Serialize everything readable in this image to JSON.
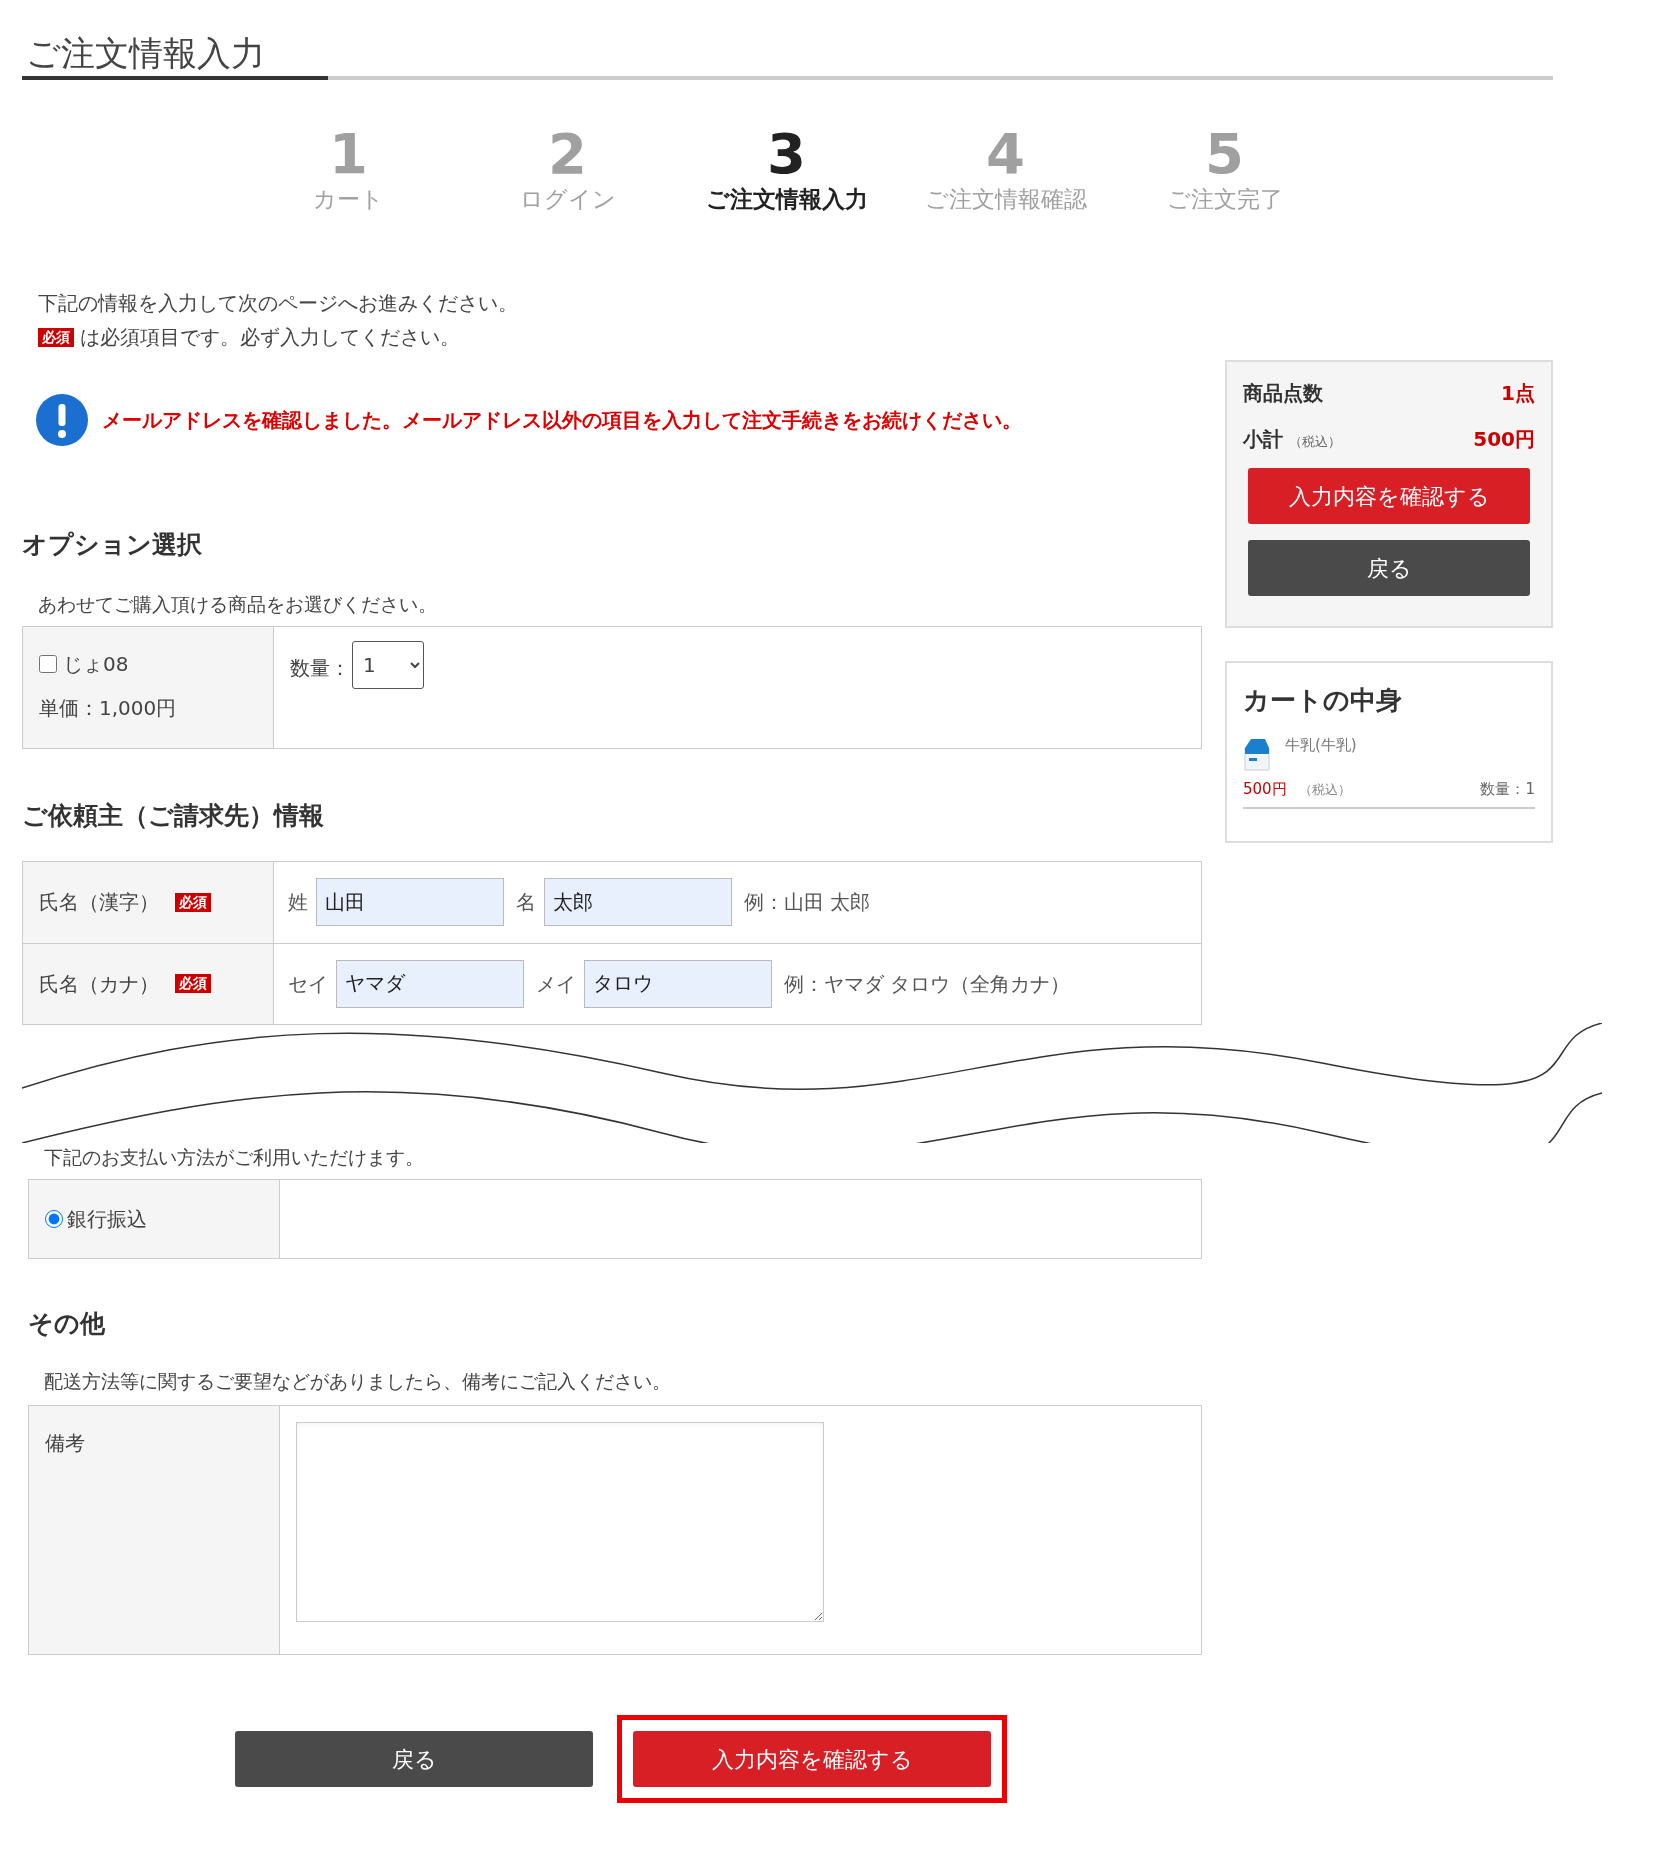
{
  "page_title": "ご注文情報入力",
  "steps": [
    {
      "number": "1",
      "label": "カート",
      "selected": false
    },
    {
      "number": "2",
      "label": "ログイン",
      "selected": false
    },
    {
      "number": "3",
      "label": "ご注文情報入力",
      "selected": true
    },
    {
      "number": "4",
      "label": "ご注文情報確認",
      "selected": false
    },
    {
      "number": "5",
      "label": "ご注文完了",
      "selected": false
    }
  ],
  "intro": "下記の情報を入力して次のページへお進みください。",
  "required_note": {
    "badge": "必須",
    "text": "は必須項目です。必ず入力してください。"
  },
  "notice": "メールアドレスを確認しました。メールアドレス以外の項目を入力して注文手続きをお続けください。",
  "options_section": {
    "heading": "オプション選択",
    "description": "あわせてご購入頂ける商品をお選びください。",
    "items": [
      {
        "name": "じょ08",
        "checked": false,
        "unit_price": "単価：1,000円",
        "quantity_label": "数量：",
        "quantity": "1"
      }
    ]
  },
  "requester_section": {
    "heading": "ご依頼主（ご請求先）情報",
    "rows": [
      {
        "label": "氏名（漢字）",
        "required_badge": "必須",
        "fields": [
          {
            "prefix": "姓",
            "value": "山田"
          },
          {
            "prefix": "名",
            "value": "太郎"
          }
        ],
        "example": "例：山田 太郎"
      },
      {
        "label": "氏名（カナ）",
        "required_badge": "必須",
        "fields": [
          {
            "prefix": "セイ",
            "value": "ヤマダ"
          },
          {
            "prefix": "メイ",
            "value": "タロウ"
          }
        ],
        "example": "例：ヤマダ タロウ（全角カナ）"
      }
    ]
  },
  "payment_section": {
    "description": "下記のお支払い方法がご利用いただけます。",
    "methods": [
      {
        "label": "銀行振込",
        "selected": true
      }
    ]
  },
  "other_section": {
    "heading": "その他",
    "description": "配送方法等に関するご要望などがありましたら、備考にご記入ください。",
    "remarks_label": "備考"
  },
  "summary": {
    "count_label": "商品点数",
    "count": "1点",
    "subtotal_label": "小計",
    "tax_note": "（税込）",
    "subtotal": "500円",
    "confirm_button": "入力内容を確認する",
    "back_button": "戻る"
  },
  "cart": {
    "heading": "カートの中身",
    "items": [
      {
        "name": "牛乳(牛乳)",
        "price": "500円",
        "tax_note": "（税込）",
        "quantity": "数量：1"
      }
    ]
  },
  "bottom_buttons": [
    {
      "kind": "back",
      "label": "戻る",
      "highlighted": false
    },
    {
      "kind": "confirm",
      "label": "入力内容を確認する",
      "highlighted": true
    }
  ]
}
